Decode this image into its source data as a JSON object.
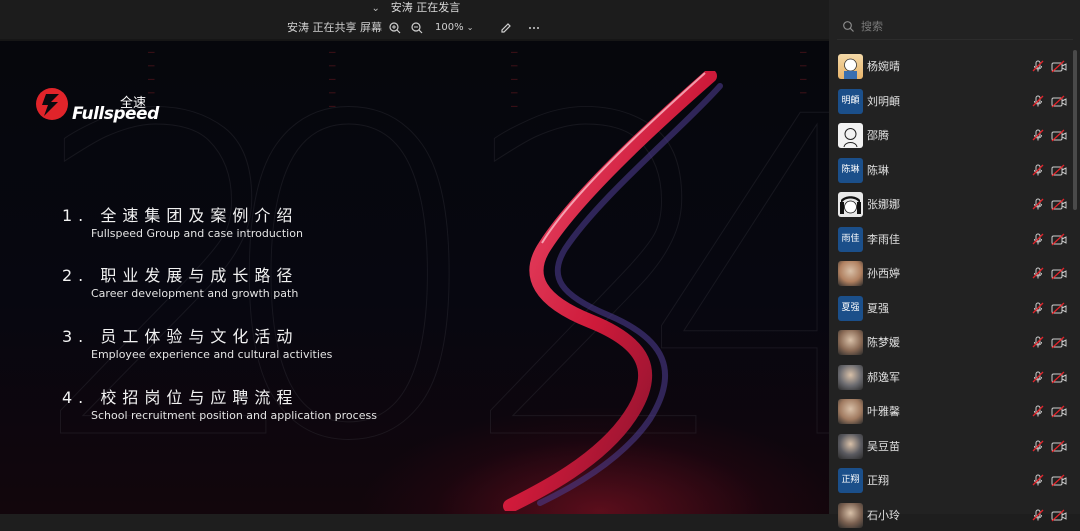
{
  "header": {
    "speaking": "安涛 正在发言"
  },
  "toolbar": {
    "sharing": "安涛 正在共享 屏幕",
    "zoom": "100%"
  },
  "slide": {
    "logo_text": "Fullspeed",
    "logo_cn": "全速",
    "agenda": [
      {
        "zh": "1. 全速集团及案例介绍",
        "en": "Fullspeed Group and case introduction"
      },
      {
        "zh": "2. 职业发展与成长路径",
        "en": "Career development and growth path"
      },
      {
        "zh": "3. 员工体验与文化活动",
        "en": "Employee experience and cultural activities"
      },
      {
        "zh": "4. 校招岗位与应聘流程",
        "en": "School recruitment position and application process"
      }
    ]
  },
  "sidebar": {
    "search_placeholder": "搜索",
    "participants": [
      {
        "name": "杨婉晴",
        "avatar": "cartoon-photo"
      },
      {
        "name": "刘明頔",
        "avatar_text": "明頔"
      },
      {
        "name": "邵腾",
        "avatar": "sketch-photo"
      },
      {
        "name": "陈琳",
        "avatar_text": "陈琳"
      },
      {
        "name": "张娜娜",
        "avatar": "anime-photo"
      },
      {
        "name": "李雨佳",
        "avatar_text": "雨佳"
      },
      {
        "name": "孙西婷",
        "avatar": "photo"
      },
      {
        "name": "夏强",
        "avatar_text": "夏强"
      },
      {
        "name": "陈梦媛",
        "avatar": "photo"
      },
      {
        "name": "郝逸军",
        "avatar": "photo"
      },
      {
        "name": "叶雅馨",
        "avatar": "photo"
      },
      {
        "name": "吴豆苗",
        "avatar": "photo"
      },
      {
        "name": "正翔",
        "avatar_text": "正翔"
      },
      {
        "name": "石小玲",
        "avatar": "photo"
      }
    ]
  },
  "colors": {
    "accent_red": "#e0242a",
    "avatar_blue": "#1b4f8a",
    "panel_bg": "#222222"
  }
}
